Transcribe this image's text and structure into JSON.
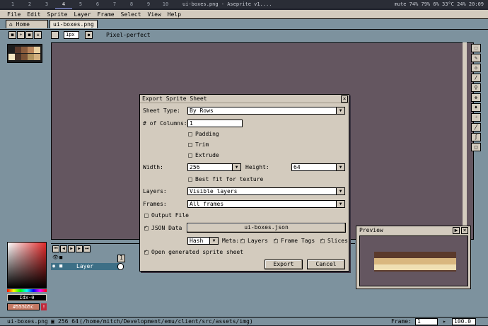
{
  "topbar": {
    "workspaces": [
      "1",
      "2",
      "3",
      "4",
      "5",
      "6",
      "7",
      "8",
      "9",
      "10"
    ],
    "active_workspace": "4",
    "window_title": "ui-boxes.png - Aseprite v1....",
    "status": "mute  74%  79%  6%  33°C  24%  20:09"
  },
  "menu": [
    "File",
    "Edit",
    "Sprite",
    "Layer",
    "Frame",
    "Select",
    "View",
    "Help"
  ],
  "tabs": {
    "home": "Home",
    "file": "ui-boxes.png"
  },
  "toolbar": {
    "brush_size": "1px",
    "pixel_perfect": "Pixel-perfect"
  },
  "palette_colors": [
    "#1e1e1e",
    "#5b3a2b",
    "#8a5c3c",
    "#b9855b",
    "#e9d0a0",
    "#f4e6c2",
    "#4a3428",
    "#7a5235",
    "#b0935e",
    "#d2b07e"
  ],
  "color_picker": {
    "index": "Idx-0",
    "hex": "#555b5c",
    "warning": "!"
  },
  "timeline": {
    "frame_number": "1",
    "layer_name": "Layer"
  },
  "status": {
    "filename": "ui-boxes.png",
    "size": "256 64",
    "path": "(/home/mitch/Development/emu/client/src/assets/img)",
    "frame_label": "Frame:",
    "frame_value": "1",
    "zoom": "100.0"
  },
  "preview": {
    "title": "Preview"
  },
  "dialog": {
    "title": "Export Sprite Sheet",
    "sheet_type_label": "Sheet Type:",
    "sheet_type_value": "By Rows",
    "columns_label": "# of Columns:",
    "columns_value": "1",
    "padding": "Padding",
    "trim": "Trim",
    "extrude": "Extrude",
    "width_label": "Width:",
    "width_value": "256",
    "height_label": "Height:",
    "height_value": "64",
    "best_fit": "Best fit for texture",
    "layers_label": "Layers:",
    "layers_value": "Visible layers",
    "frames_label": "Frames:",
    "frames_value": "All frames",
    "output_file": "Output File",
    "json_data": "JSON Data",
    "json_file": "ui-boxes.json",
    "json_format": "Hash",
    "meta_label": "Meta:",
    "meta_layers": "Layers",
    "meta_frame_tags": "Frame Tags",
    "meta_slices": "Slices",
    "open_generated": "Open generated sprite sheet",
    "export_button": "Export",
    "cancel_button": "Cancel"
  }
}
